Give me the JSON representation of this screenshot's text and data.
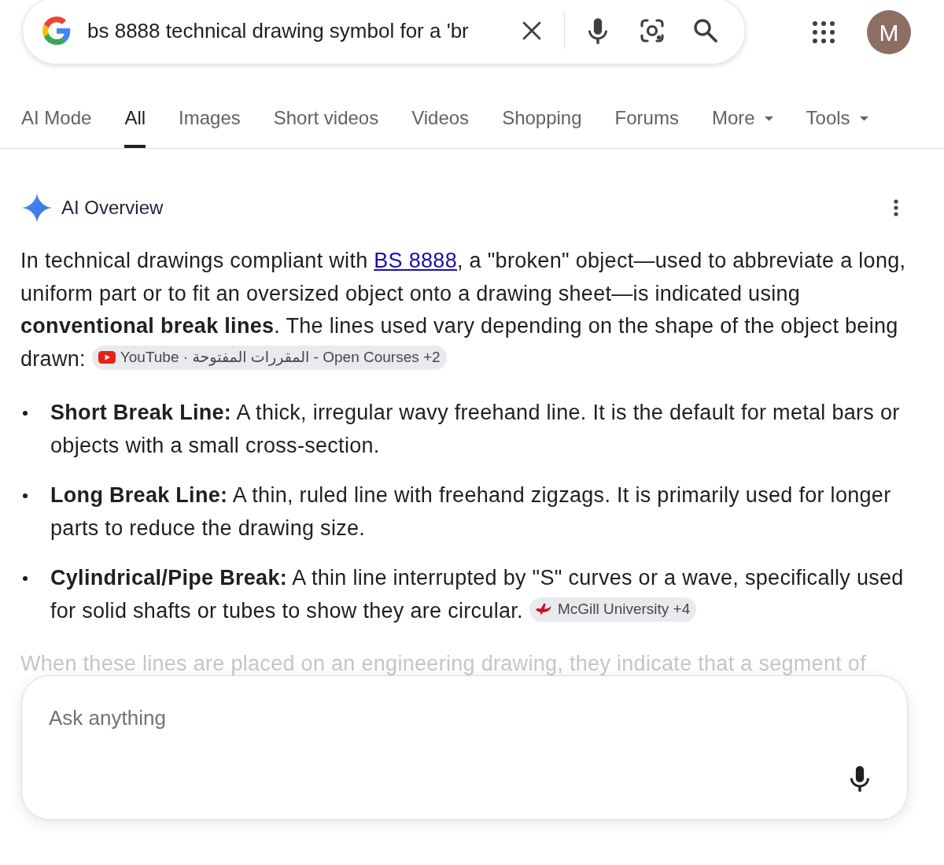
{
  "search": {
    "value": "bs 8888 technical drawing symbol for a 'br"
  },
  "account": {
    "initial": "M"
  },
  "tabs": [
    {
      "label": "AI Mode",
      "selected": false,
      "dropdown": false
    },
    {
      "label": "All",
      "selected": true,
      "dropdown": false
    },
    {
      "label": "Images",
      "selected": false,
      "dropdown": false
    },
    {
      "label": "Short videos",
      "selected": false,
      "dropdown": false
    },
    {
      "label": "Videos",
      "selected": false,
      "dropdown": false
    },
    {
      "label": "Shopping",
      "selected": false,
      "dropdown": false
    },
    {
      "label": "Forums",
      "selected": false,
      "dropdown": false
    },
    {
      "label": "More",
      "selected": false,
      "dropdown": true
    },
    {
      "label": "Tools",
      "selected": false,
      "dropdown": true
    }
  ],
  "overview": {
    "title": "AI Overview",
    "paragraph": {
      "start": "In technical drawings compliant with",
      "link": "BS 8888",
      "rest": ", a \"broken\" object—used to abbreviate a long, uniform part or to fit an oversized object onto a drawing sheet—is indicated using **conventional break lines**. The lines used vary depending on the shape of the object being drawn:",
      "source": {
        "kind": "video",
        "label": "YouTube · المقررات المفتوحة - Open Courses +2"
      }
    },
    "bullets": [
      {
        "text": "**Short Break Line:** A thick, irregular wavy freehand line. It is the default for metal bars or objects with a small cross-section."
      },
      {
        "text": "**Long Break Line:** A thin, ruled line with freehand zigzags. It is primarily used for longer parts to reduce the drawing size."
      },
      {
        "text": "**Cylindrical/Pipe Break:** A thin line interrupted by \"S\" curves or a wave, specifically used for solid shafts or tubes to show they are circular.",
        "source": {
          "kind": "university",
          "label": "McGill University +4"
        }
      }
    ],
    "faded_text": "When these lines are placed on an engineering drawing, they indicate that a segment of"
  },
  "ask": {
    "placeholder": "Ask anything"
  }
}
